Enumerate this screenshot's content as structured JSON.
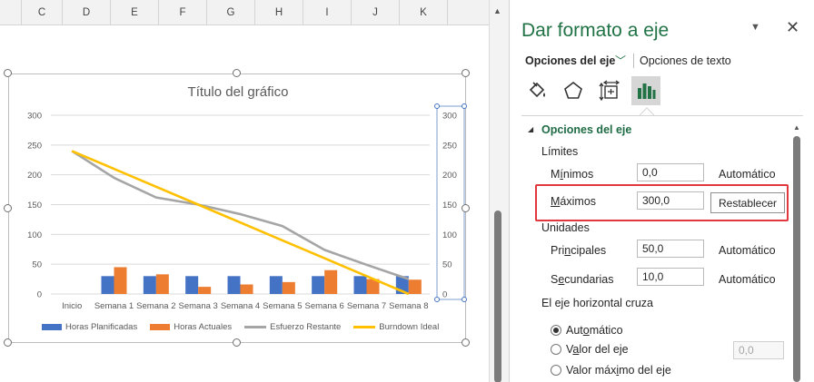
{
  "sheet": {
    "columns": [
      "C",
      "D",
      "E",
      "F",
      "G",
      "H",
      "I",
      "J",
      "K"
    ]
  },
  "chart_data": {
    "type": "bar",
    "title": "Título del gráfico",
    "categories": [
      "Inicio",
      "Semana 1",
      "Semana 2",
      "Semana 3",
      "Semana 4",
      "Semana 5",
      "Semana 6",
      "Semana 7",
      "Semana 8"
    ],
    "series": [
      {
        "name": "Horas Planificadas",
        "type": "bar",
        "color": "#4472C4",
        "values": [
          null,
          30,
          30,
          30,
          30,
          30,
          30,
          30,
          30
        ]
      },
      {
        "name": "Horas Actuales",
        "type": "bar",
        "color": "#ED7D31",
        "values": [
          null,
          45,
          33,
          12,
          16,
          20,
          40,
          25,
          24
        ]
      },
      {
        "name": "Esfuerzo Restante",
        "type": "line",
        "color": "#A5A5A5",
        "values": [
          240,
          195,
          162,
          150,
          134,
          114,
          74,
          49,
          25
        ]
      },
      {
        "name": "Burndown Ideal",
        "type": "line",
        "color": "#FFC000",
        "values": [
          240,
          210,
          180,
          150,
          120,
          90,
          60,
          30,
          0
        ]
      }
    ],
    "ylim": [
      0,
      300
    ],
    "yticks": [
      0,
      50,
      100,
      150,
      200,
      250,
      300
    ],
    "y2lim": [
      0,
      300
    ],
    "y2ticks": [
      0,
      50,
      100,
      150,
      200,
      250,
      300
    ],
    "grid": true,
    "legend": "bottom"
  },
  "pane": {
    "title": "Dar formato a eje",
    "tab_axis": "Opciones del eje",
    "tab_text": "Opciones de texto",
    "section": "Opciones del eje",
    "limits_label": "Límites",
    "min_label": "Mínimos",
    "min_value": "0,0",
    "min_state": "Automático",
    "max_label": "Máximos",
    "max_value": "300,0",
    "reset_label": "Restablecer",
    "units_label": "Unidades",
    "major_label": "Principales",
    "major_value": "50,0",
    "major_state": "Automático",
    "minor_label": "Secundarias",
    "minor_value": "10,0",
    "minor_state": "Automático",
    "cross_label": "El eje horizontal cruza",
    "radio_auto": "Automático",
    "radio_value": "Valor del eje",
    "radio_value_field": "0,0",
    "radio_max": "Valor máximo del eje"
  }
}
